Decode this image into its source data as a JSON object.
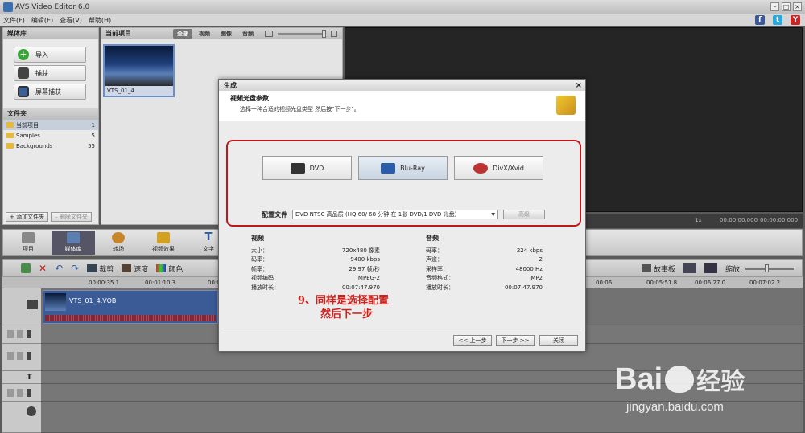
{
  "window": {
    "title": "AVS Video Editor 6.0"
  },
  "menu": [
    "文件(F)",
    "编辑(E)",
    "查看(V)",
    "帮助(H)"
  ],
  "social": [
    {
      "label": "f",
      "color": "#3b5998"
    },
    {
      "label": "t",
      "color": "#2aa9e0"
    },
    {
      "label": "Y",
      "color": "#cc2222"
    }
  ],
  "media_panel": {
    "header": "媒体库",
    "buttons": [
      "导入",
      "捕获",
      "屏幕捕获"
    ],
    "folders_header": "文件夹",
    "folders": [
      {
        "name": "当前项目",
        "count": "1"
      },
      {
        "name": "Samples",
        "count": "5"
      },
      {
        "name": "Backgrounds",
        "count": "55"
      }
    ],
    "add_folder": "添加文件夹",
    "del_folder": "删除文件夹"
  },
  "project_panel": {
    "header": "当前项目",
    "filters": [
      "全部",
      "视频",
      "图像",
      "音频"
    ],
    "clip_name": "VTS_01_4"
  },
  "preview": {
    "time_left": "00:00:00.000",
    "time_right": "00:00:00.000",
    "zoom": "1x"
  },
  "tools": [
    "项目",
    "媒体库",
    "转场",
    "视频效果",
    "文字"
  ],
  "timeline": {
    "toolbar": [
      "裁剪",
      "速度",
      "颜色"
    ],
    "storyboard": "故事板",
    "zoom_label": "缩放:",
    "ruler_ticks": [
      "00:00:35.1",
      "00:01:10.3",
      "00:0",
      "00:06",
      "00:05:51.8",
      "00:06:27.0",
      "00:07:02.2"
    ],
    "clip_label": "VTS_01_4.VOB"
  },
  "dialog": {
    "title": "生成",
    "heading": "视频光盘参数",
    "subheading": "选择一种合适的视频光盘类型 然后按\"下一步\"。",
    "disc_buttons": [
      "DVD",
      "Blu-Ray",
      "DivX/Xvid"
    ],
    "profile_label": "配置文件",
    "profile_value": "DVD NTSC 高品质 (HQ 60/ 68 分钟 在 1张 DVD/1 DVD 光盘)",
    "advanced": "高级",
    "video_header": "视频",
    "audio_header": "音频",
    "video_rows": [
      {
        "k": "大小：",
        "v": "720x480 像素"
      },
      {
        "k": "码率：",
        "v": "9400 kbps"
      },
      {
        "k": "帧率：",
        "v": "29.97 帧/秒"
      },
      {
        "k": "视频编码：",
        "v": "MPEG-2"
      },
      {
        "k": "播放时长：",
        "v": "00:07:47.970"
      }
    ],
    "audio_rows": [
      {
        "k": "码率：",
        "v": "224 kbps"
      },
      {
        "k": "声道：",
        "v": "2"
      },
      {
        "k": "采样率：",
        "v": "48000 Hz"
      },
      {
        "k": "音频格式：",
        "v": "MP2"
      },
      {
        "k": "播放时长：",
        "v": "00:07:47.970"
      }
    ],
    "back": "<< 上一步",
    "next": "下一步 >>",
    "close": "关闭"
  },
  "annotation": {
    "line1": "9、同样是选择配置",
    "line2": "然后下一步"
  },
  "watermark": {
    "brand_left": "Bai",
    "brand_cn": "经验",
    "url": "jingyan.baidu.com"
  },
  "colors": {
    "accent_red": "#c2161e",
    "annotation_red": "#d0201c",
    "baidu_blue": "#2b6bc8"
  }
}
